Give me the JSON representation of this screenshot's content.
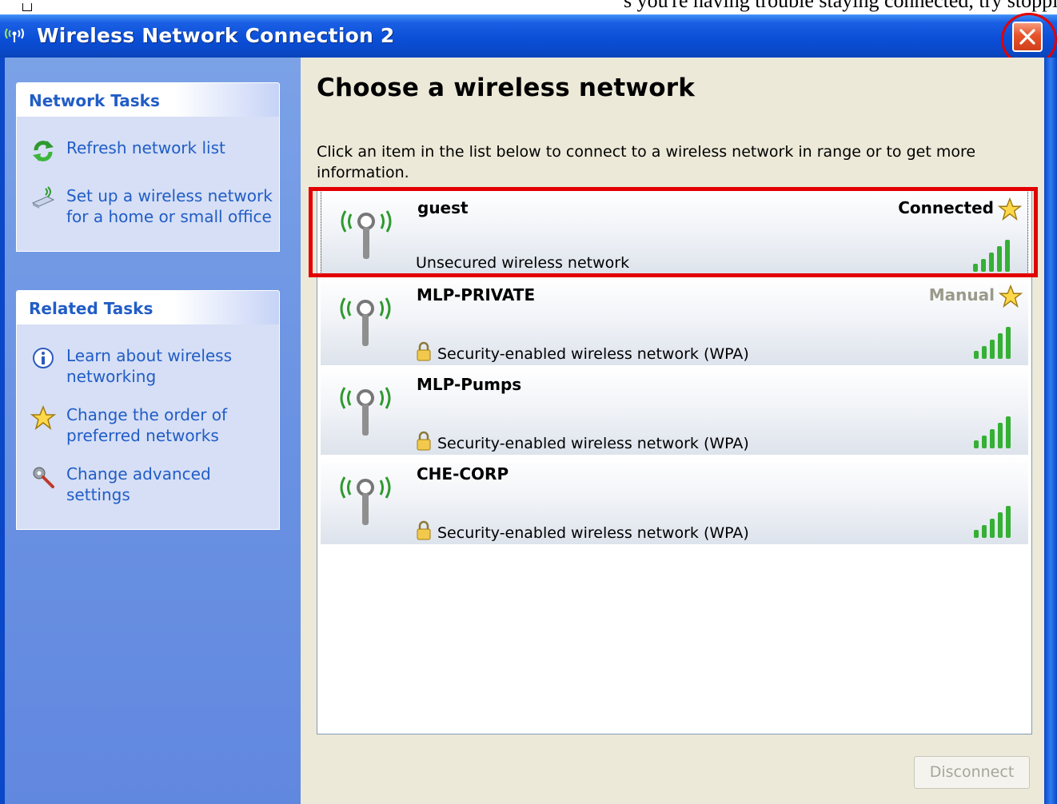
{
  "page_caption": "s you're having trouble staying connected, try stopping th",
  "window": {
    "title": "Wireless Network Connection 2",
    "close_icon": "close-icon"
  },
  "sidebar": {
    "network_tasks": {
      "header": "Network Tasks",
      "items": [
        {
          "label": "Refresh network list",
          "icon": "refresh-icon"
        },
        {
          "label": "Set up a wireless network for a home or small office",
          "icon": "setup-wizard-icon"
        }
      ]
    },
    "related_tasks": {
      "header": "Related Tasks",
      "items": [
        {
          "label": "Learn about wireless networking",
          "icon": "info-icon"
        },
        {
          "label": "Change the order of preferred networks",
          "icon": "star-icon"
        },
        {
          "label": "Change advanced settings",
          "icon": "settings-icon"
        }
      ]
    }
  },
  "main": {
    "heading": "Choose a wireless network",
    "description": "Click an item in the list below to connect to a wireless network in range or to get more information.",
    "networks": [
      {
        "name": "guest",
        "security": "Unsecured wireless network",
        "status": "Connected",
        "secured": false,
        "selected": true,
        "signal_bars": 5
      },
      {
        "name": "MLP-PRIVATE",
        "security": "Security-enabled wireless network (WPA)",
        "status": "Manual",
        "secured": true,
        "selected": false,
        "signal_bars": 5
      },
      {
        "name": "MLP-Pumps",
        "security": "Security-enabled wireless network (WPA)",
        "status": "",
        "secured": true,
        "selected": false,
        "signal_bars": 5
      },
      {
        "name": "CHE-CORP",
        "security": "Security-enabled wireless network (WPA)",
        "status": "",
        "secured": true,
        "selected": false,
        "signal_bars": 5
      }
    ],
    "disconnect_label": "Disconnect"
  },
  "colors": {
    "titlebar": "#0a48c8",
    "link": "#215dc6",
    "annotation": "#e20000"
  }
}
